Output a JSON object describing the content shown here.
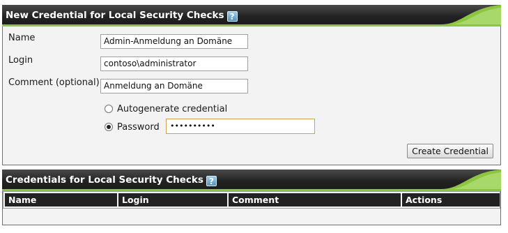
{
  "new_credential": {
    "title": "New Credential for Local Security Checks",
    "fields": {
      "name_label": "Name",
      "name_value": "Admin-Anmeldung an Domäne",
      "login_label": "Login",
      "login_value": "contoso\\administrator",
      "comment_label": "Comment (optional)",
      "comment_value": "Anmeldung an Domäne"
    },
    "options": {
      "autogenerate_label": "Autogenerate credential",
      "password_label": "Password",
      "password_value": "••••••••••",
      "selected": "password"
    },
    "create_button": "Create Credential"
  },
  "credentials_list": {
    "title": "Credentials for Local Security Checks",
    "columns": [
      "Name",
      "Login",
      "Comment",
      "Actions"
    ]
  },
  "colors": {
    "header_dark": "#222222",
    "accent_green": "#8cc63f",
    "focus_border": "#d4a04a"
  }
}
